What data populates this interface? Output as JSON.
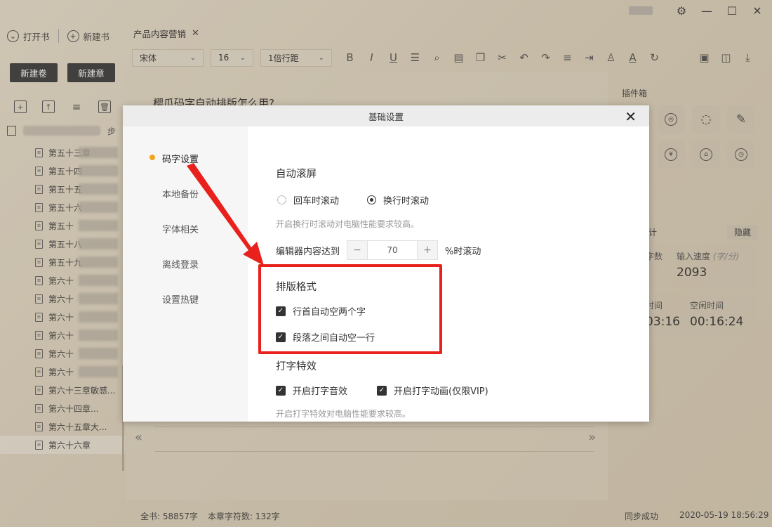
{
  "window": {
    "controls": [
      "gear-icon",
      "minimize-icon",
      "maximize-icon",
      "close-icon"
    ]
  },
  "sidebar": {
    "open_book": "打开书",
    "new_book": "新建书",
    "new_volume": "新建卷",
    "new_chapter": "新建章",
    "book_title_tail": "步",
    "chapters": [
      {
        "label": "第五十三章"
      },
      {
        "label": "第五十四"
      },
      {
        "label": "第五十五"
      },
      {
        "label": "第五十六"
      },
      {
        "label": "第五十"
      },
      {
        "label": "第五十八"
      },
      {
        "label": "第五十九"
      },
      {
        "label": "第六十"
      },
      {
        "label": "第六十"
      },
      {
        "label": "第六十"
      },
      {
        "label": "第六十"
      },
      {
        "label": "第六十"
      },
      {
        "label": "第六十"
      },
      {
        "label": "第六十三章敏感..."
      },
      {
        "label": "第六十四章..."
      },
      {
        "label": "第六十五章大..."
      },
      {
        "label": "第六十六章"
      }
    ]
  },
  "tab": {
    "label": "产品内容营销",
    "close": "✕"
  },
  "toolbar": {
    "font": "宋体",
    "size": "16",
    "line_spacing": "1倍行距",
    "icons": [
      "bold-icon",
      "italic-icon",
      "underline-icon",
      "strikethrough-icon",
      "search-icon",
      "note-icon",
      "copy-icon",
      "cut-icon",
      "undo-icon",
      "redo-icon",
      "align-icon",
      "indent-icon",
      "theme-icon",
      "font-color-icon",
      "refresh-icon",
      "save-icon",
      "save-as-icon",
      "download-icon"
    ]
  },
  "editor": {
    "doc_title": "樱瓜码字自动排版怎么用?"
  },
  "plugins": {
    "label": "插件箱",
    "stats_label": "计",
    "hide": "隐藏",
    "word_count_label": "字数",
    "speed_label": "输入速度",
    "speed_unit": "(字/分)",
    "speed_value": "2093",
    "time_label": "时间",
    "time_value": "03:16",
    "idle_label": "空闲时间",
    "idle_value": "00:16:24"
  },
  "status": {
    "total": "全书: 58857字",
    "chapter": "本章字符数: 132字",
    "sync": "同步成功",
    "datetime": "2020-05-19 18:56:29"
  },
  "modal": {
    "title": "基础设置",
    "close": "✕",
    "nav": [
      "码字设置",
      "本地备份",
      "字体相关",
      "离线登录",
      "设置热键"
    ],
    "auto_scroll": {
      "title": "自动滚屏",
      "option_enter": "回车时滚动",
      "option_newline": "换行时滚动",
      "hint": "开启换行时滚动对电脑性能要求较高。",
      "threshold_label": "编辑器内容达到",
      "threshold_value": "70",
      "threshold_suffix": "%时滚动",
      "minus": "−",
      "plus": "+"
    },
    "layout": {
      "title": "排版格式",
      "indent": "行首自动空两个字",
      "blank_line": "段落之间自动空一行"
    },
    "effects": {
      "title": "打字特效",
      "sound": "开启打字音效",
      "animation": "开启打字动画(仅限VIP)",
      "hint": "开启打字特效对电脑性能要求较高。"
    }
  },
  "colors": {
    "annotation": "#e8211c",
    "active_dot": "#f2a51a"
  }
}
